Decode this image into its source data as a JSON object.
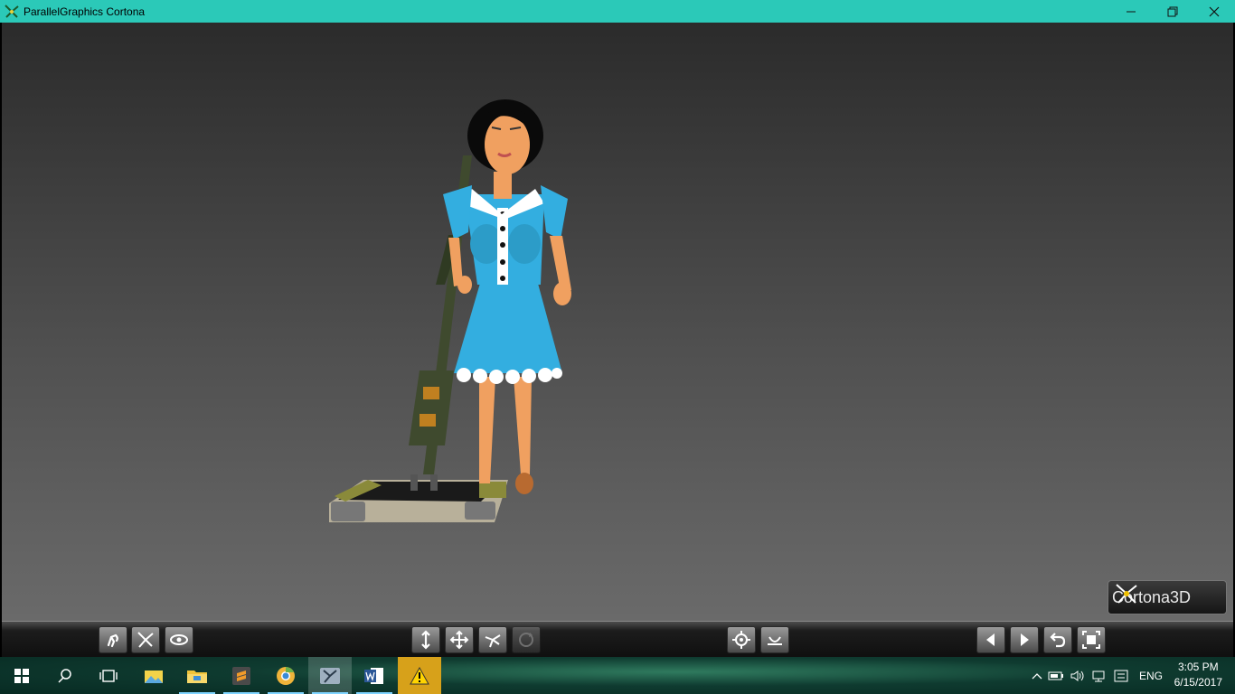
{
  "window": {
    "title": "ParallelGraphics Cortona",
    "controls": [
      "minimize-icon",
      "restore-icon",
      "close-icon"
    ]
  },
  "viewport": {
    "brand_text": "Cortona3D"
  },
  "toolbar": {
    "groups": [
      [
        "walk-icon",
        "fly-icon",
        "study-icon"
      ],
      [
        "plan-icon",
        "pan-icon",
        "turn-icon",
        "roll-icon"
      ],
      [
        "goto-icon",
        "align-icon"
      ],
      [
        "prev-viewpoint-icon",
        "next-viewpoint-icon",
        "restore-view-icon",
        "fit-icon"
      ]
    ],
    "disabled": [
      "roll-icon"
    ]
  },
  "taskbar": {
    "apps": [
      "start-icon",
      "search-icon",
      "task-view-icon",
      "photos-icon",
      "file-explorer-icon",
      "sublime-icon",
      "chrome-canary-icon",
      "cortona-icon",
      "word-icon",
      "warning-icon"
    ],
    "language": "ENG",
    "time": "3:05 PM",
    "date": "6/15/2017"
  },
  "colors": {
    "titlebar": "#2bc9b8",
    "dress": "#33aee0",
    "skin": "#f0a060",
    "vacuum": "#3f4a2e"
  }
}
